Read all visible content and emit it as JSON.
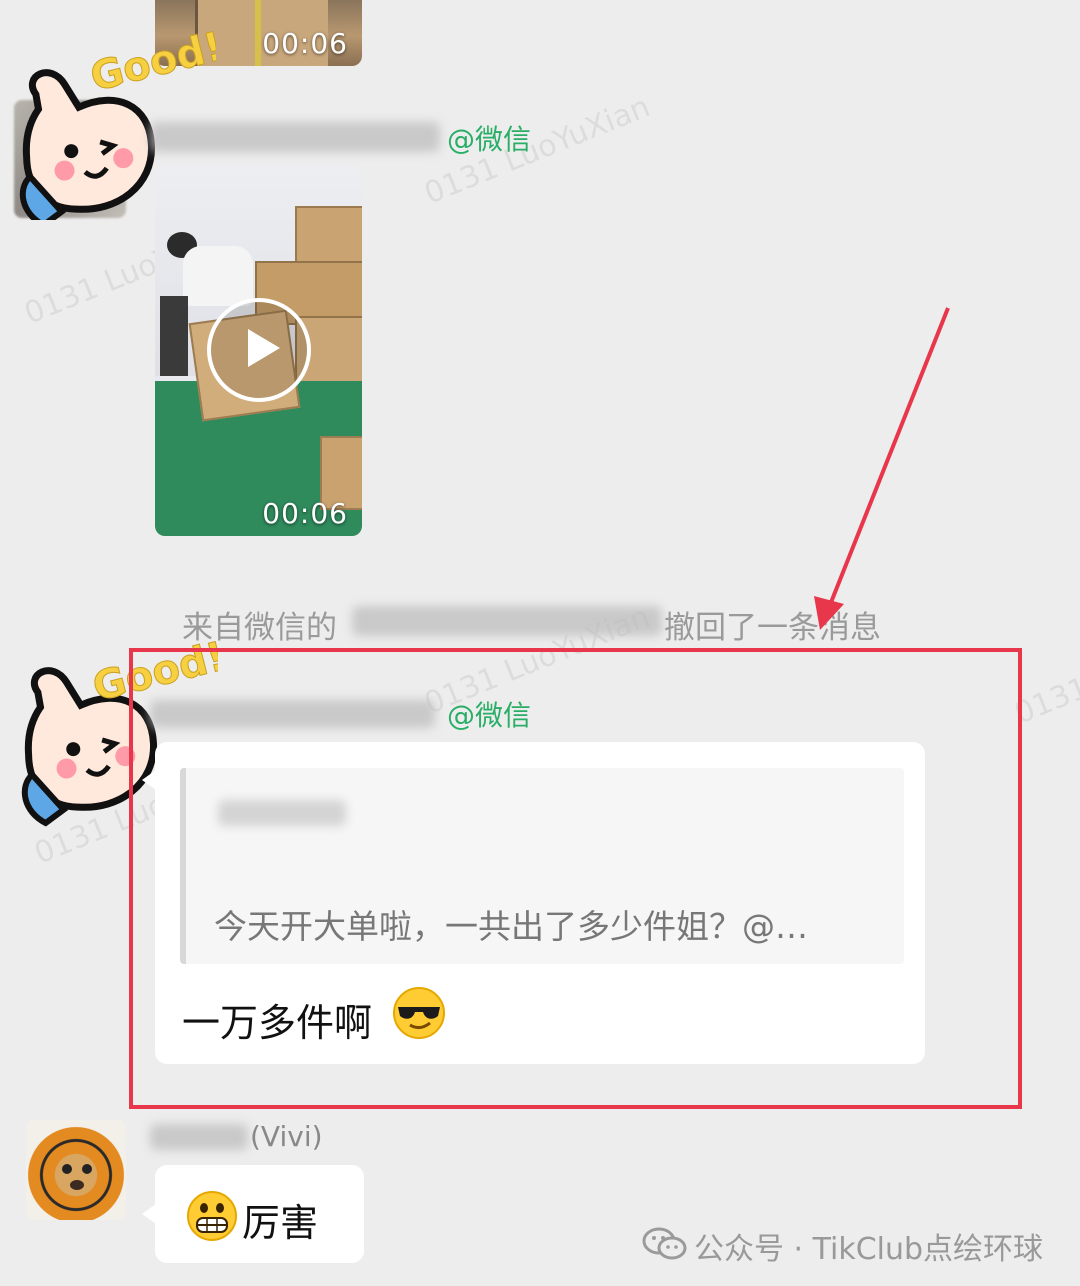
{
  "messages": {
    "video_1": {
      "duration": "00:06"
    },
    "msg_2": {
      "sender_suffix": "@微信",
      "duration": "00:06"
    },
    "recall_notice": {
      "prefix": "来自微信的",
      "suffix": "撤回了一条消息"
    },
    "msg_3": {
      "sender_suffix": "@微信",
      "quoted_text": "今天开大单啦，一共出了多少件姐？@…",
      "reply_text": "一万多件啊"
    },
    "msg_4": {
      "sender_suffix": "(Vivi)",
      "text": "厉害"
    }
  },
  "stickers": {
    "good_label": "Good!"
  },
  "footer": {
    "label": "公众号 · TikClub点绘环球"
  },
  "watermark": {
    "text": "0131 LuoYuXian"
  },
  "icons": [
    "play-icon",
    "sunglasses-emoji",
    "grin-emoji",
    "wechat-icon",
    "arrow-icon"
  ],
  "colors": {
    "highlight": "#e8364b",
    "wechat_green": "#2aae67",
    "background": "#ededed"
  }
}
